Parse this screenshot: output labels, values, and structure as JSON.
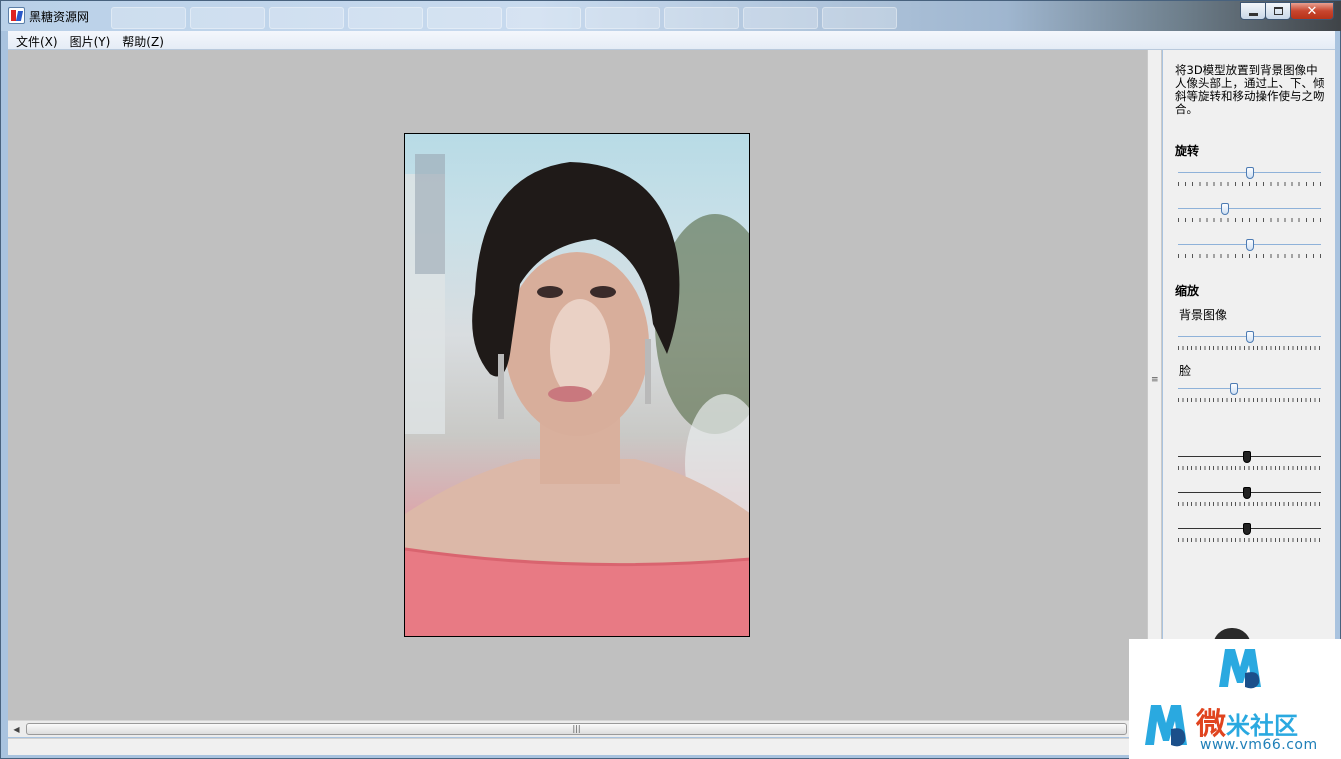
{
  "window": {
    "title": "黑糖资源网"
  },
  "menu": {
    "items": [
      "文件(X)",
      "图片(Y)",
      "帮助(Z)"
    ]
  },
  "panel": {
    "description": "将3D模型放置到背景图像中人像头部上，通过上、下、倾斜等旋转和移动操作使与之吻合。",
    "rotation_label": "旋转",
    "zoom_label": "缩放",
    "background_label": "背景图像",
    "face_label": "脸",
    "rotation_sliders": [
      0.5,
      0.33,
      0.5
    ],
    "background_slider": 0.5,
    "face_slider": 0.39,
    "extra_sliders": [
      0.48,
      0.48,
      0.48
    ]
  },
  "scrollbar": {
    "grip": "|||"
  },
  "watermark": {
    "brand_first": "微",
    "brand_rest": "米社区",
    "url": "www.vm66.com"
  },
  "colors": {
    "canvas_bg": "#c0c0c0",
    "panel_bg": "#f0f0f0",
    "slider_accent": "#4d7bb3",
    "watermark_red": "#e0441f",
    "watermark_blue": "#2aa9e0"
  }
}
